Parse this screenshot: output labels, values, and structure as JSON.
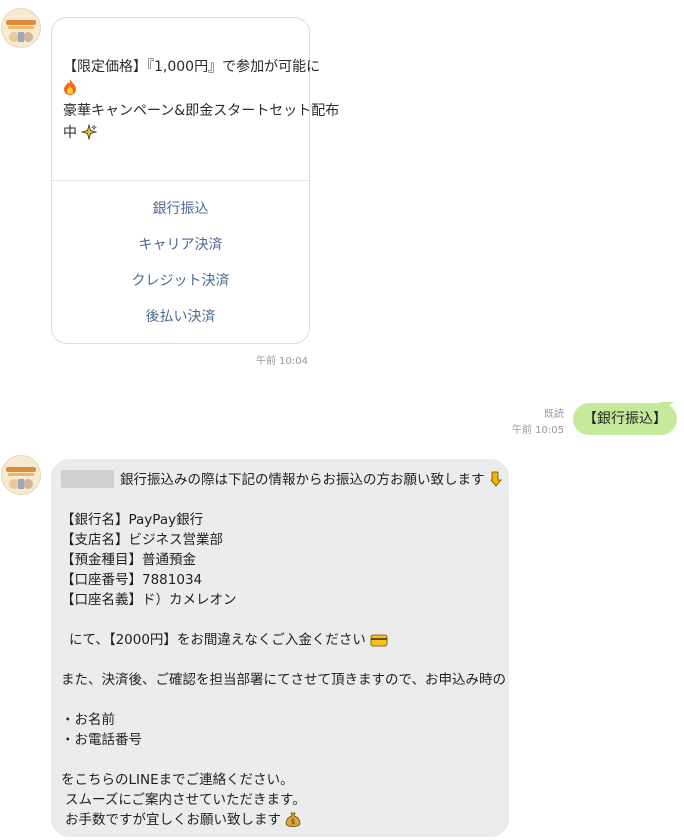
{
  "card": {
    "lines": [
      "【限定価格】『1,000円』で参加が可能に",
      "豪華キャンペーン&即金スタートセット配布",
      "中"
    ],
    "actions": [
      "銀行振込",
      "キャリア決済",
      "クレジット決済",
      "後払い決済"
    ],
    "timestamp": "午前 10:04"
  },
  "sent": {
    "text": "【銀行振込】",
    "read": "既読",
    "timestamp": "午前 10:05"
  },
  "received": {
    "line1": "銀行振込みの際は下記の情報からお振込の方お願い致します",
    "bank_name": "【銀行名】PayPay銀行",
    "branch": "【支店名】ビジネス営業部",
    "account_type": "【預金種目】普通預金",
    "account_number": "【口座番号】7881034",
    "account_holder": "【口座名義】ド）カメレオン",
    "amount_line": "にて、【2000円】をお間違えなくご入金ください",
    "after_payment": "また、決済後、ご確認を担当部署にてさせて頂きますので、お申込み時の",
    "item_name": "・お名前",
    "item_phone": "・お電話番号",
    "contact": "をこちらのLINEまでご連絡ください。",
    "guide": "スムーズにご案内させていただきます。",
    "closing": "お手数ですが宜しくお願い致します"
  },
  "icons": {
    "avatar": "avatar-image",
    "fire": "fire-emoji",
    "sparkle": "sparkles-emoji",
    "pointing": "pointing-down-emoji",
    "card": "credit-card-emoji",
    "money": "money-bag-emoji"
  }
}
